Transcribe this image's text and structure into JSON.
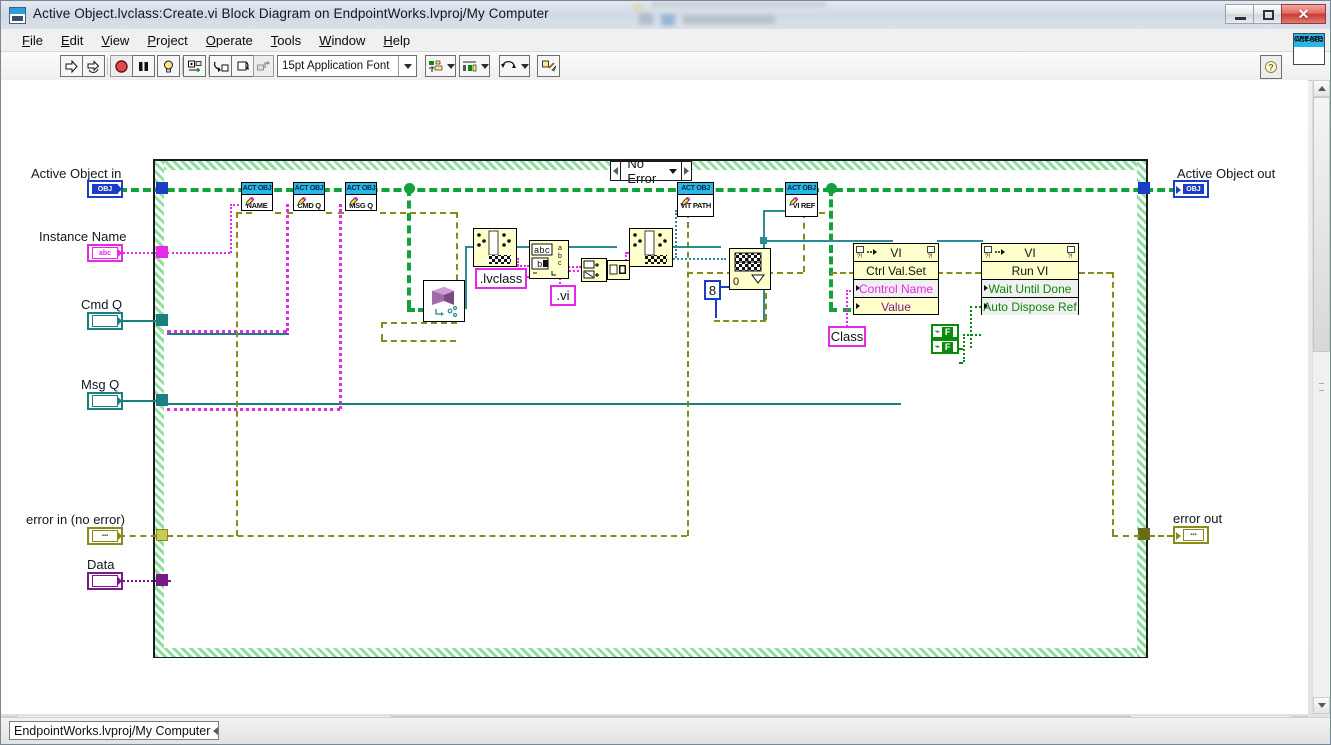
{
  "window": {
    "title": "Active Object.lvclass:Create.vi Block Diagram on EndpointWorks.lvproj/My Computer",
    "minimize_label": "Minimize",
    "maximize_label": "Maximize",
    "close_label": "✕"
  },
  "menu": [
    {
      "label": "File",
      "accel": "F"
    },
    {
      "label": "Edit",
      "accel": "E"
    },
    {
      "label": "View",
      "accel": "V"
    },
    {
      "label": "Project",
      "accel": "P"
    },
    {
      "label": "Operate",
      "accel": "O"
    },
    {
      "label": "Tools",
      "accel": "T"
    },
    {
      "label": "Window",
      "accel": "W"
    },
    {
      "label": "Help",
      "accel": "H"
    }
  ],
  "toolbar": {
    "run_label": "run-arrow",
    "run_continuous_label": "run-continuously",
    "abort_label": "abort-execution",
    "pause_label": "pause",
    "highlight_label": "highlight-execution",
    "retain_values_label": "retain-wire-values",
    "step_into_label": "step-into",
    "step_over_label": "step-over",
    "step_out_label": "step-out",
    "font": "15pt Application Font",
    "align_label": "align-objects",
    "distribute_label": "distribute-objects",
    "reorder_label": "reorder",
    "cleanup_label": "clean-up-diagram",
    "help_label": "?"
  },
  "vi_icon": {
    "top": "ACT OBJ",
    "bottom": "CREATE"
  },
  "statusbar": {
    "context": "EndpointWorks.lvproj/My Computer"
  },
  "diagram": {
    "case_selector": "No Error",
    "inputs": [
      {
        "label": "Active Object in",
        "type": "OBJ",
        "color": "#1a3fc4"
      },
      {
        "label": "Instance Name",
        "type": "abc",
        "color": "#e828e8"
      },
      {
        "label": "Cmd Q",
        "type": "queue",
        "color": "#1a7f7f"
      },
      {
        "label": "Msg Q",
        "type": "queue",
        "color": "#1a7f7f"
      },
      {
        "label": "error in (no error)",
        "type": "error",
        "color": "#8a8a1a"
      },
      {
        "label": "Data",
        "type": "variant",
        "color": "#7a1a8a"
      }
    ],
    "outputs": [
      {
        "label": "Active Object out",
        "type": "OBJ",
        "color": "#1a3fc4"
      },
      {
        "label": "error out",
        "type": "error",
        "color": "#8a8a1a"
      }
    ],
    "property_nodes": [
      {
        "class": "ACT OBJ",
        "property": "NAME"
      },
      {
        "class": "ACT OBJ",
        "property": "CMD Q"
      },
      {
        "class": "ACT OBJ",
        "property": "MSG Q"
      },
      {
        "class": "ACT OBJ",
        "property": "VIT PATH"
      },
      {
        "class": "ACT OBJ",
        "property": "VI REF"
      }
    ],
    "invoke_nodes": [
      {
        "class": "VI",
        "method": "Ctrl Val.Set",
        "params": [
          {
            "name": "Control Name",
            "color": "#e828e8"
          },
          {
            "name": "Value",
            "color": "#7a1a8a"
          }
        ]
      },
      {
        "class": "VI",
        "method": "Run VI",
        "params": [
          {
            "name": "Wait Until Done",
            "color": "#0a8a0a"
          },
          {
            "name": "Auto Dispose Ref",
            "color": "#0a8a0a"
          }
        ]
      }
    ],
    "constants": [
      {
        "value": ".lvclass",
        "kind": "string"
      },
      {
        "value": ".vi",
        "kind": "string"
      },
      {
        "value": "Class",
        "kind": "string"
      },
      {
        "value": "8",
        "kind": "numeric"
      },
      {
        "value": "F",
        "kind": "boolean"
      },
      {
        "value": "F",
        "kind": "boolean"
      },
      {
        "value": "0",
        "kind": "index"
      }
    ],
    "function_nodes": [
      {
        "name": "to-more-specific-class"
      },
      {
        "name": "strip-path"
      },
      {
        "name": "search-replace-string"
      },
      {
        "name": "format-into-string"
      },
      {
        "name": "concatenate-strings"
      },
      {
        "name": "build-path"
      },
      {
        "name": "index-array"
      }
    ]
  }
}
